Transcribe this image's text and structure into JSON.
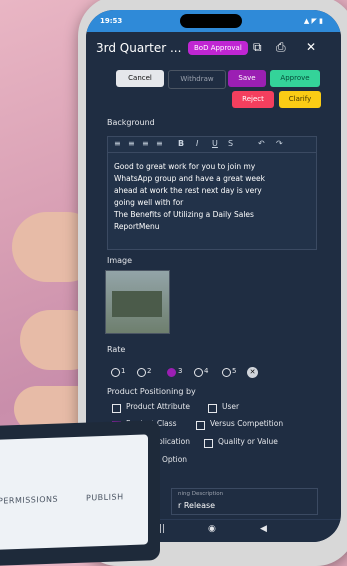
{
  "status": {
    "time": "19:53",
    "icons": "▲ ◤ ▮"
  },
  "header": {
    "title": "3rd Quarter ...",
    "badge": "BoD Approval"
  },
  "actions": {
    "cancel": "Cancel",
    "withdraw": "Withdraw",
    "save": "Save",
    "approve": "Approve",
    "reject": "Reject",
    "clarify": "Clarify"
  },
  "background": {
    "label": "Background",
    "lines": [
      "Good to great work for you to join my",
      "WhatsApp group and have a great week",
      "ahead at work the rest next day is very",
      "going well with for",
      "The Benefits of Utilizing a Daily Sales",
      "ReportMenu"
    ]
  },
  "image": {
    "label": "Image"
  },
  "rate": {
    "label": "Rate",
    "options": [
      "1",
      "2",
      "3",
      "4",
      "5"
    ],
    "selected": "3"
  },
  "positioning": {
    "label": "Product Positioning by",
    "options": [
      {
        "label": "Product Attribute",
        "checked": false
      },
      {
        "label": "User",
        "checked": false
      },
      {
        "label": "Product Class",
        "checked": true
      },
      {
        "label": "Versus Competition",
        "checked": false
      },
      {
        "label": "plication",
        "checked": false
      },
      {
        "label": "Quality or Value",
        "checked": false
      },
      {
        "label": "Option",
        "checked": false
      }
    ]
  },
  "description": {
    "label": "ning Description",
    "value": "r Release"
  },
  "laptop": {
    "tab1": "PERMISSIONS",
    "tab2": "PUBLISH"
  },
  "colors": {
    "screen_bg": "#1f2d42",
    "accent": "#9b1fb3",
    "approve": "#34d399",
    "reject": "#f43f5e",
    "clarify": "#facc15"
  }
}
